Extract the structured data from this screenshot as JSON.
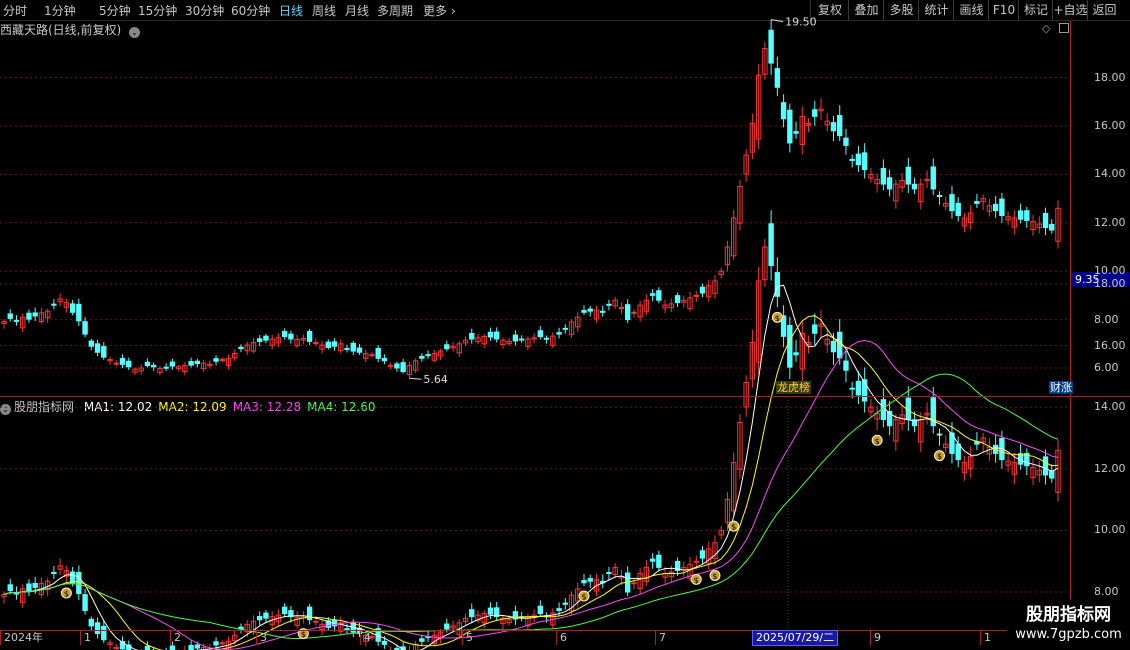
{
  "toolbar": {
    "timeframes": [
      "分时",
      "1分钟",
      "5分钟",
      "15分钟",
      "30分钟",
      "60分钟",
      "日线",
      "周线",
      "月线",
      "多周期",
      "更多"
    ],
    "active_timeframe": "日线",
    "more_chevron": "›",
    "right_buttons": [
      "复权",
      "叠加",
      "多股",
      "统计",
      "画线",
      "F10",
      "标记",
      "+自选",
      "返回"
    ]
  },
  "main_chart": {
    "title": "西藏天路(日线,前复权)",
    "current_price_label": "9.35",
    "high_annotation": "19.50",
    "low_annotation": "5.64",
    "badge_longhu": "龙虎榜",
    "badge_caizhang": "财涨"
  },
  "indicator": {
    "name": "股朋指标网",
    "ma_values": [
      {
        "label": "MA1: 12.02",
        "color": "#ffffff"
      },
      {
        "label": "MA2: 12.09",
        "color": "#ffff00"
      },
      {
        "label": "MA3: 12.28",
        "color": "#ff44ff"
      },
      {
        "label": "MA4: 12.60",
        "color": "#44ff44"
      }
    ]
  },
  "axes": {
    "main_y_ticks": [
      "18.00",
      "16.00",
      "14.00",
      "12.00",
      "10.00",
      "8.00",
      "6.00"
    ],
    "sub_y_ticks": [
      "18.00",
      "16.00",
      "14.00",
      "12.00",
      "10.00",
      "8.00"
    ],
    "date_labels": [
      "2024年",
      "1",
      "2",
      "3",
      "4",
      "5",
      "6",
      "7",
      "9",
      "1"
    ],
    "crosshair_date": "2025/07/29/二"
  },
  "colors": {
    "up": "#ff3232",
    "down": "#54ffff",
    "grid": "#7a1a1a",
    "axis": "#b02020"
  },
  "chart_data": {
    "type": "candlestick",
    "title": "西藏天路(日线,前复权)",
    "x_start": "2024年",
    "close_series": [
      7.92,
      8.05,
      7.95,
      8.1,
      8.02,
      8.15,
      8.28,
      8.35,
      8.6,
      8.85,
      8.7,
      8.3,
      7.95,
      7.4,
      6.9,
      6.65,
      6.45,
      6.35,
      6.2,
      6.15,
      6.05,
      5.95,
      6.0,
      6.1,
      6.05,
      5.98,
      6.02,
      6.08,
      6.05,
      6.1,
      6.12,
      6.18,
      6.2,
      6.15,
      6.28,
      6.35,
      6.4,
      6.6,
      6.8,
      6.95,
      7.05,
      7.1,
      7.15,
      7.2,
      7.25,
      7.3,
      7.2,
      7.18,
      7.22,
      7.1,
      7.05,
      6.95,
      6.85,
      6.9,
      7.0,
      6.8,
      6.7,
      6.65,
      6.6,
      6.55,
      6.4,
      6.3,
      6.1,
      6.0,
      5.85,
      6.1,
      6.3,
      6.4,
      6.55,
      6.6,
      6.7,
      6.8,
      6.9,
      7.0,
      7.15,
      7.2,
      7.25,
      7.3,
      7.28,
      7.2,
      7.15,
      7.1,
      7.12,
      7.18,
      7.2,
      7.25,
      7.3,
      7.2,
      7.32,
      7.4,
      7.6,
      7.9,
      8.1,
      8.3,
      8.35,
      8.4,
      8.3,
      8.6,
      8.8,
      8.5,
      8.0,
      8.3,
      8.6,
      8.8,
      9.0,
      8.8,
      8.6,
      8.65,
      8.7,
      8.8,
      8.9,
      9.0,
      9.1,
      9.4,
      9.6,
      10.0,
      11.0,
      12.2,
      13.5,
      14.8,
      16.1,
      18.1,
      19.2,
      18.6,
      17.6,
      16.3,
      15.3,
      15.7,
      16.4,
      16.1,
      16.4,
      16.7,
      16.2,
      15.8,
      15.6,
      15.2,
      14.6,
      14.4,
      14.2,
      14.0,
      13.8,
      13.6,
      13.4,
      13.6,
      13.75,
      13.6,
      13.4,
      13.6,
      13.8,
      13.4,
      13.1,
      12.8,
      12.5,
      12.3,
      12.2,
      12.4,
      12.8,
      13.0,
      12.7,
      12.5,
      12.3,
      12.25,
      12.2,
      12.15,
      12.1,
      12.05,
      11.95,
      11.8,
      11.7,
      12.6
    ],
    "x_axis_labels": [
      "2024年",
      "1",
      "2",
      "3",
      "4",
      "5",
      "6",
      "7",
      "9",
      "1"
    ],
    "y_ticks_main": [
      6,
      8,
      10,
      12,
      14,
      16,
      18
    ],
    "ma": {
      "MA1": 12.02,
      "MA2": 12.09,
      "MA3": 12.28,
      "MA4": 12.6
    },
    "max_marker": 19.5,
    "min_marker": 5.64,
    "last_price": 9.35,
    "crosshair_date": "2025/07/29/二"
  }
}
